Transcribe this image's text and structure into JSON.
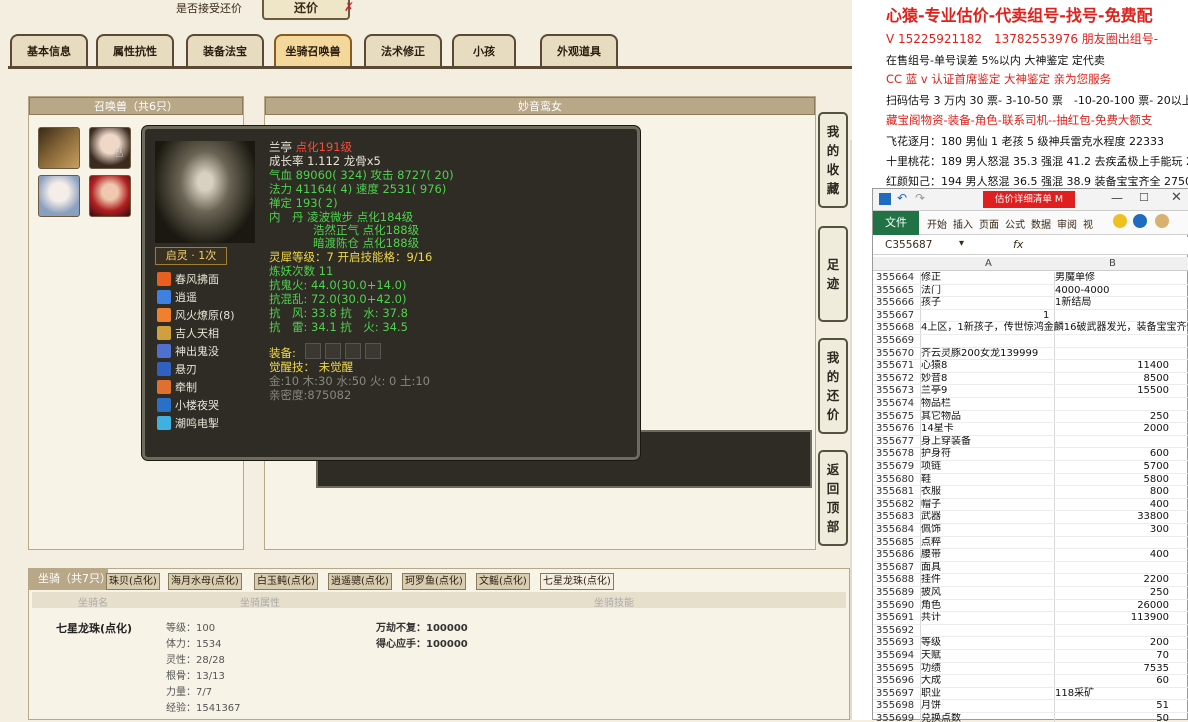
{
  "top_question": "是否接受还价",
  "top_button": "还价",
  "tabs": [
    "基本信息",
    "属性抗性",
    "装备法宝",
    "坐骑召唤兽",
    "法术修正",
    "小孩",
    "外观道具"
  ],
  "summon_panel_title": "召唤兽（共6只）",
  "pet_name_title": "妙音鸾女",
  "tooltip": {
    "name": "兰亭",
    "name_suffix": "点化191级",
    "growth": "成长率 1.112 龙骨x5",
    "hp": "气血 89060( 324) 攻击 8727( 20)",
    "mp": "法力 41164( 4) 速度 2531( 976)",
    "zen": "禅定 193( 2)",
    "neidan1": "内　丹 凌波微步 点化184级",
    "neidan2": "浩然正气 点化188级",
    "neidan3": "暗渡陈仓 点化188级",
    "spirit_level": "灵犀等级：7 开启技能格：9/16",
    "refine": "炼妖次数 11",
    "resist1": "抗鬼火: 44.0(30.0+14.0)",
    "resist2": "抗混乱: 72.0(30.0+42.0)",
    "resist3": "抗　风: 33.8 抗　水: 37.8",
    "resist4": "抗　雷: 34.1 抗　火: 34.5",
    "equip_label": "装备:",
    "awaken": "觉醒技： 未觉醒",
    "elements": "金:10 木:30 水:50 火: 0 土:10",
    "intimacy": "亲密度:875082",
    "qiling": "启灵 · 1次",
    "skills": [
      "春风拂面",
      "逍遥",
      "风火燎原(8)",
      "吉人天相",
      "神出鬼没",
      "悬刃",
      "牵制",
      "小楼夜哭",
      "潮鸣电掣"
    ]
  },
  "side_buttons": [
    {
      "label": [
        "我",
        "的",
        "收",
        "藏"
      ]
    },
    {
      "label": [
        "足",
        "迹"
      ]
    },
    {
      "label": [
        "我",
        "的",
        "还",
        "价"
      ]
    },
    {
      "label": [
        "返",
        "回",
        "顶",
        "部"
      ]
    }
  ],
  "mount": {
    "title": "坐骑（共7只）",
    "tabs": [
      "珠贝(点化)",
      "海月水母(点化)",
      "白玉鲀(点化)",
      "逍遥骢(点化)",
      "珂罗鱼(点化)",
      "文鳐(点化)",
      "七星龙珠(点化)"
    ],
    "col_name": "坐骑名",
    "col_attr": "坐骑属性",
    "col_skill": "坐骑技能",
    "name": "七星龙珠(点化)",
    "attrs": [
      "等级：100",
      "体力：1534",
      "灵性：28/28",
      "根骨：13/13",
      "力量：7/7",
      "经验：1541367"
    ],
    "skills": [
      "万劫不复：100000",
      "得心应手：100000"
    ]
  },
  "ad": {
    "headline": "心猿-专业估价-代卖组号-找号-免费配",
    "lines": [
      {
        "text": "V 15225921182　13782553976 朋友圈出组号-",
        "color": "#e0201a"
      },
      {
        "text": "在售组号-单号误差 5%以内 大神鉴定 定代卖",
        "color": "#111"
      },
      {
        "text": "CC 蓝 v 认证首席鉴定 大神鉴定 亲为您服务",
        "color": "#e0201a"
      },
      {
        "text": "扫码估号 3 万内 30 票- 3-10-50 票　-10-20-100 票- 20以上 150",
        "color": "#111"
      },
      {
        "text": "藏宝阁物资-装备-角色-联系司机--抽红包-免费大额支",
        "color": "#e0201a"
      },
      {
        "text": "飞花逐月：180 男仙 1 老孩 5 级神兵雷克水程度 22333",
        "color": "#111"
      },
      {
        "text": "十里桃花：189 男人怒混 35.3 强混 41.2 去疾孟极上手能玩 2",
        "color": "#111"
      },
      {
        "text": "红颜知己：194 男人怒混 36.5 强混 38.9 装备宝宝齐全 27500",
        "color": "#111"
      }
    ]
  },
  "excel": {
    "quick_tab": "估价详细清单 M",
    "ribbon": [
      "文件",
      "开始",
      "插入",
      "页面",
      "公式",
      "数据",
      "审阅",
      "视"
    ],
    "name_box": "C355687",
    "fx": "fx",
    "col_a": "A",
    "col_b": "B",
    "rows": [
      {
        "n": "355664",
        "a": "修正",
        "b": "男魔单修",
        "num": false
      },
      {
        "n": "355665",
        "a": "法门",
        "b": "4000-4000",
        "num": false
      },
      {
        "n": "355666",
        "a": "孩子",
        "b": "1新结局",
        "num": false
      },
      {
        "n": "355667",
        "a": "",
        "b": "1",
        "num": true,
        "left": true
      },
      {
        "n": "355668",
        "a": "4上区，1新孩子，传世惊鸿金麟16破武器发光，装备宝宝齐全",
        "b": "",
        "num": false
      },
      {
        "n": "355669",
        "a": "",
        "b": "",
        "num": false
      },
      {
        "n": "355670",
        "a": "齐云灵豚200女龙139999",
        "b": "",
        "num": false
      },
      {
        "n": "355671",
        "a": "心猿8",
        "b": "11400",
        "num": true
      },
      {
        "n": "355672",
        "a": "妙音8",
        "b": "8500",
        "num": true
      },
      {
        "n": "355673",
        "a": "兰亭9",
        "b": "15500",
        "num": true
      },
      {
        "n": "355674",
        "a": "物品栏",
        "b": "",
        "num": false
      },
      {
        "n": "355675",
        "a": "其它物品",
        "b": "250",
        "num": true
      },
      {
        "n": "355676",
        "a": "14星卡",
        "b": "2000",
        "num": true
      },
      {
        "n": "355677",
        "a": "身上穿装备",
        "b": "",
        "num": false
      },
      {
        "n": "355678",
        "a": "护身符",
        "b": "600",
        "num": true
      },
      {
        "n": "355679",
        "a": "项链",
        "b": "5700",
        "num": true
      },
      {
        "n": "355680",
        "a": "鞋",
        "b": "5800",
        "num": true
      },
      {
        "n": "355681",
        "a": "衣服",
        "b": "800",
        "num": true
      },
      {
        "n": "355682",
        "a": "帽子",
        "b": "400",
        "num": true
      },
      {
        "n": "355683",
        "a": "武器",
        "b": "33800",
        "num": true
      },
      {
        "n": "355684",
        "a": "佩饰",
        "b": "300",
        "num": true
      },
      {
        "n": "355685",
        "a": "点粹",
        "b": "",
        "num": false
      },
      {
        "n": "355686",
        "a": "腰带",
        "b": "400",
        "num": true
      },
      {
        "n": "355687",
        "a": "面具",
        "b": "",
        "num": false
      },
      {
        "n": "355688",
        "a": "挂件",
        "b": "2200",
        "num": true
      },
      {
        "n": "355689",
        "a": "披风",
        "b": "250",
        "num": true
      },
      {
        "n": "355690",
        "a": "角色",
        "b": "26000",
        "num": true
      },
      {
        "n": "355691",
        "a": "共计",
        "b": "113900",
        "num": true
      },
      {
        "n": "355692",
        "a": "",
        "b": "",
        "num": false
      },
      {
        "n": "355693",
        "a": "等级",
        "b": "200",
        "num": true
      },
      {
        "n": "355694",
        "a": "天赋",
        "b": "70",
        "num": true
      },
      {
        "n": "355695",
        "a": "功绩",
        "b": "7535",
        "num": true
      },
      {
        "n": "355696",
        "a": "大成",
        "b": "60",
        "num": true
      },
      {
        "n": "355697",
        "a": "职业",
        "b": "118采矿",
        "num": false
      },
      {
        "n": "355698",
        "a": "月饼",
        "b": "51",
        "num": true
      },
      {
        "n": "355699",
        "a": "兑换点数",
        "b": "50",
        "num": true
      }
    ]
  }
}
